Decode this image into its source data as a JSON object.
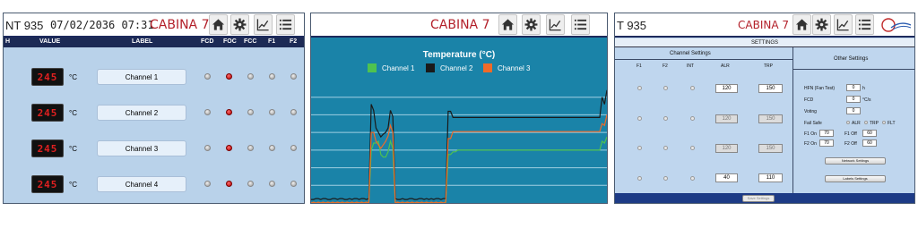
{
  "panel1": {
    "header_left": "NT 935",
    "datetime": "07/02/2036 07:31",
    "title": "CABINA 7",
    "columns": [
      "H",
      "VALUE",
      "LABEL",
      "FCD",
      "FOC",
      "FCC",
      "F1",
      "F2"
    ],
    "unit": "°C",
    "channels": [
      {
        "value": "245",
        "label": "Channel 1",
        "leds": [
          false,
          true,
          false,
          false,
          false
        ]
      },
      {
        "value": "245",
        "label": "Channel 2",
        "leds": [
          false,
          true,
          false,
          false,
          false
        ]
      },
      {
        "value": "245",
        "label": "Channel 3",
        "leds": [
          false,
          true,
          false,
          false,
          false
        ]
      },
      {
        "value": "245",
        "label": "Channel 4",
        "leds": [
          false,
          true,
          false,
          false,
          false
        ]
      }
    ]
  },
  "panel2": {
    "title": "CABINA 7",
    "chart_data": {
      "type": "line",
      "title": "Temperature (°C)",
      "xlabel": "",
      "ylabel": "",
      "grid": true,
      "legend": "top",
      "series": [
        {
          "name": "Channel 1",
          "color": "#4fc24f",
          "values": [
            0,
            0,
            0,
            0,
            0,
            0,
            0,
            0,
            0,
            0,
            0,
            0,
            0,
            0,
            0,
            0,
            0,
            0,
            0,
            0,
            0,
            0,
            0,
            0,
            0,
            60,
            68,
            68,
            70,
            55,
            52,
            52,
            58,
            70,
            62,
            0,
            0,
            0,
            0,
            0,
            0,
            0,
            0,
            0,
            0,
            0,
            0,
            0,
            0,
            0,
            0,
            0,
            0,
            0,
            0,
            0,
            0,
            55,
            55,
            58,
            58,
            60,
            60,
            60,
            60,
            60,
            60,
            60,
            60,
            60,
            60,
            60,
            60,
            60,
            60,
            60,
            60,
            60,
            60,
            60,
            60,
            60,
            60,
            60,
            60,
            60,
            60,
            60,
            60,
            60,
            60,
            60,
            60,
            60,
            60,
            60,
            60,
            60,
            60,
            60,
            60,
            60,
            60,
            60,
            60,
            60,
            60,
            60,
            60,
            60,
            60,
            60,
            60,
            60,
            60,
            60,
            60,
            60,
            60,
            60,
            60,
            70,
            68,
            75
          ]
        },
        {
          "name": "Channel 2",
          "color": "#1a1a1a",
          "values": [
            4,
            4,
            5,
            5,
            4,
            5,
            5,
            4,
            4,
            5,
            5,
            4,
            5,
            5,
            4,
            4,
            5,
            4,
            5,
            5,
            4,
            5,
            5,
            4,
            5,
            112,
            105,
            85,
            80,
            75,
            78,
            80,
            85,
            105,
            98,
            5,
            4,
            4,
            5,
            4,
            4,
            5,
            5,
            4,
            4,
            5,
            5,
            4,
            5,
            4,
            5,
            4,
            5,
            5,
            4,
            5,
            5,
            104,
            104,
            97,
            97,
            97,
            97,
            97,
            97,
            97,
            97,
            97,
            97,
            97,
            97,
            97,
            97,
            97,
            97,
            97,
            97,
            97,
            97,
            97,
            97,
            97,
            97,
            97,
            97,
            97,
            97,
            97,
            97,
            97,
            97,
            97,
            97,
            97,
            97,
            97,
            97,
            97,
            97,
            97,
            97,
            97,
            97,
            97,
            97,
            97,
            97,
            97,
            97,
            97,
            97,
            97,
            97,
            97,
            97,
            97,
            97,
            97,
            97,
            97,
            97,
            120,
            112,
            128
          ]
        },
        {
          "name": "Channel 3",
          "color": "#f06a28",
          "values": [
            0,
            1,
            0,
            1,
            0,
            1,
            0,
            1,
            0,
            1,
            0,
            1,
            0,
            1,
            0,
            1,
            0,
            1,
            0,
            1,
            0,
            1,
            0,
            1,
            0,
            80,
            80,
            70,
            66,
            62,
            66,
            70,
            76,
            88,
            80,
            0,
            1,
            0,
            1,
            0,
            1,
            0,
            1,
            0,
            1,
            0,
            1,
            0,
            1,
            0,
            1,
            0,
            1,
            0,
            1,
            0,
            1,
            73,
            73,
            81,
            81,
            81,
            81,
            81,
            81,
            81,
            81,
            81,
            81,
            81,
            81,
            81,
            81,
            81,
            81,
            81,
            81,
            81,
            81,
            81,
            81,
            81,
            81,
            81,
            81,
            81,
            81,
            81,
            81,
            81,
            81,
            81,
            81,
            81,
            81,
            81,
            81,
            81,
            81,
            81,
            81,
            81,
            81,
            81,
            81,
            81,
            81,
            81,
            81,
            81,
            81,
            81,
            81,
            81,
            81,
            81,
            81,
            81,
            81,
            81,
            81,
            90,
            88,
            100
          ]
        }
      ]
    }
  },
  "panel3": {
    "header_left": "T 935",
    "title": "CABINA 7",
    "subheader": "SETTINGS",
    "channel_settings_title": "Channel Settings",
    "columns": [
      "F1",
      "F2",
      "INT",
      "ALR",
      "TRP"
    ],
    "rows": [
      {
        "alr": "120",
        "trp": "150",
        "enabled": true
      },
      {
        "alr": "120",
        "trp": "150",
        "enabled": false
      },
      {
        "alr": "120",
        "trp": "150",
        "enabled": false
      },
      {
        "alr": "40",
        "trp": "110",
        "enabled": true
      }
    ],
    "save_label": "Save Settings",
    "other_title": "Other Settings",
    "hfn_label": "HFN (Fan Test)",
    "hfn_value": "0",
    "hfn_unit": "h",
    "fcd_label": "FCD",
    "fcd_value": "0",
    "fcd_unit": "°C/s",
    "voting_label": "Voting",
    "voting_value": "0",
    "failsafe_label": "Fail Safe",
    "failsafe_options": [
      "ALR",
      "TRP",
      "FLT"
    ],
    "f1on_label": "F1 On",
    "f1on_value": "70",
    "f1off_label": "F1 Off",
    "f1off_value": "60",
    "f2on_label": "F2 On",
    "f2on_value": "70",
    "f2off_label": "F2 Off",
    "f2off_value": "60",
    "network_btn": "Network Settings",
    "labels_btn": "Labels Settings"
  }
}
